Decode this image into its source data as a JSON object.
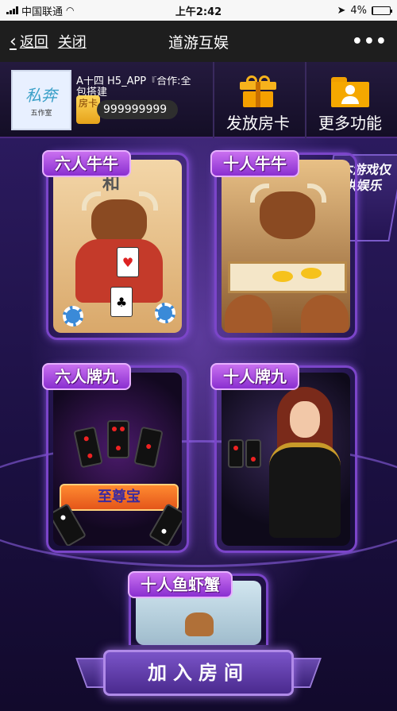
{
  "status_bar": {
    "carrier": "中国联通",
    "time": "上午2:42",
    "battery": "4%",
    "battery_level": 0.04
  },
  "nav": {
    "back_label": "返回",
    "close_label": "关闭",
    "title": "道游互娱",
    "more_label": "•••"
  },
  "header": {
    "avatar_logo": "私奔",
    "avatar_sub": "五作室",
    "user_name": "A十四 H5_APP『合作:全包搭建",
    "card_badge": "房卡",
    "card_count": "999999999",
    "buttons": {
      "distribute_label": "发放房卡",
      "more_label": "更多功能"
    }
  },
  "banner": {
    "text": "本游戏仅供娱乐"
  },
  "games": [
    {
      "label": "六人牛牛"
    },
    {
      "label": "十人牛牛"
    },
    {
      "label": "六人牌九"
    },
    {
      "label": "十人牌九"
    },
    {
      "label": "十人鱼虾蟹"
    }
  ],
  "art": {
    "domino_ribbon": "至尊宝",
    "table_mark": "和"
  },
  "join_button": {
    "label": "加入房间"
  }
}
